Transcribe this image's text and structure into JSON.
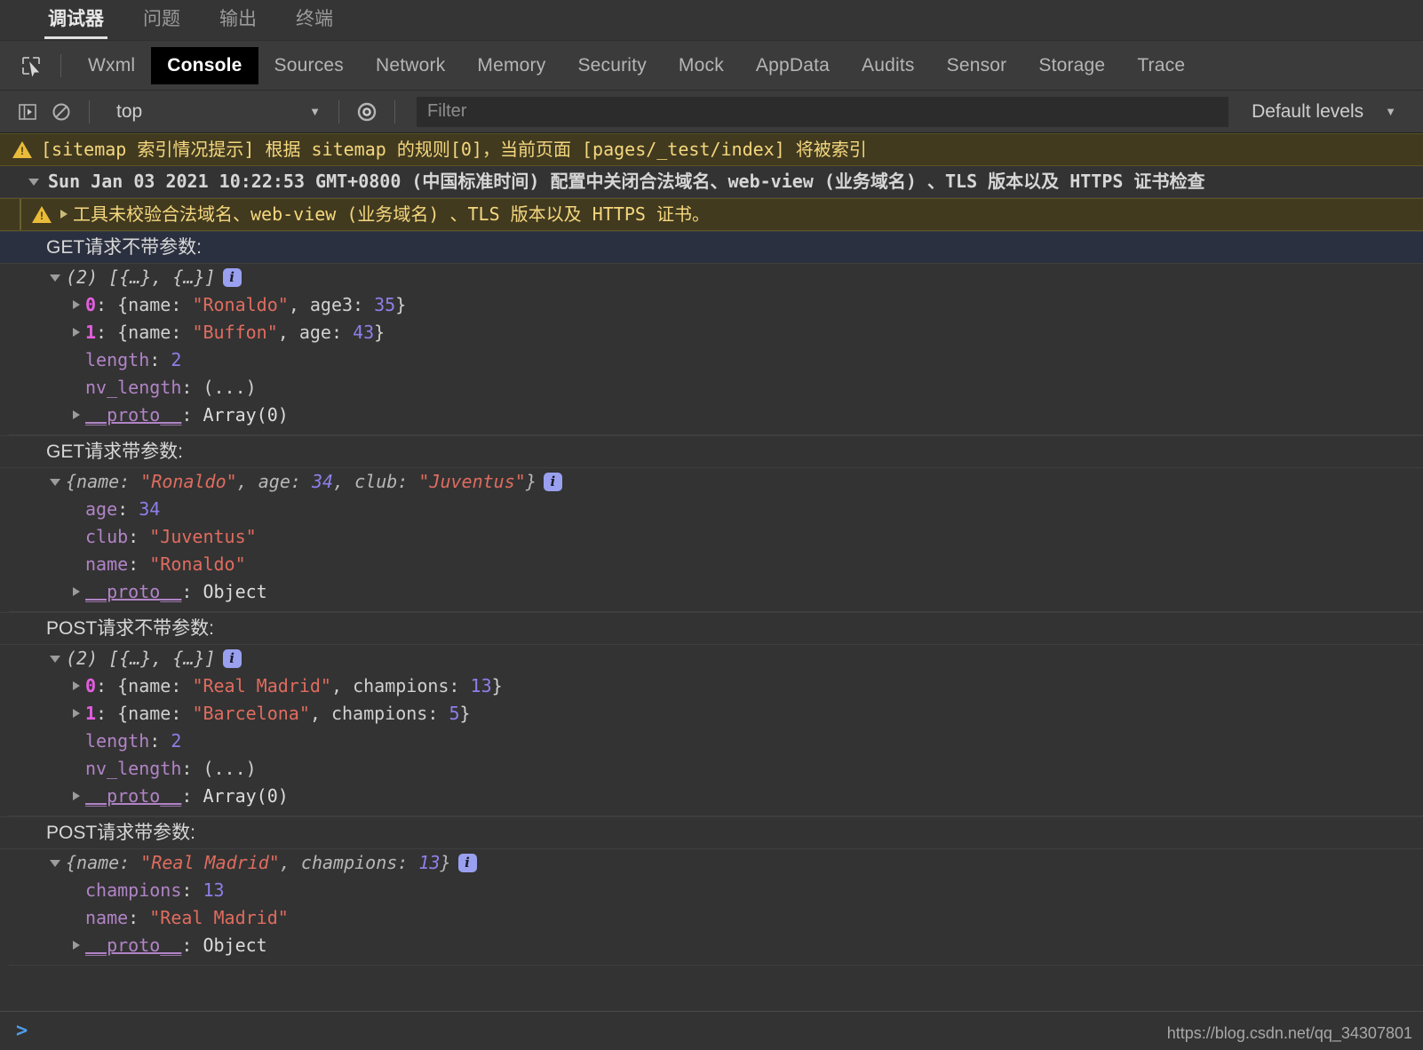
{
  "ide_tabs": [
    {
      "label": "调试器",
      "active": true
    },
    {
      "label": "问题",
      "active": false
    },
    {
      "label": "输出",
      "active": false
    },
    {
      "label": "终端",
      "active": false
    }
  ],
  "devtools_tabs": [
    {
      "label": "Wxml",
      "active": false
    },
    {
      "label": "Console",
      "active": true
    },
    {
      "label": "Sources",
      "active": false
    },
    {
      "label": "Network",
      "active": false
    },
    {
      "label": "Memory",
      "active": false
    },
    {
      "label": "Security",
      "active": false
    },
    {
      "label": "Mock",
      "active": false
    },
    {
      "label": "AppData",
      "active": false
    },
    {
      "label": "Audits",
      "active": false
    },
    {
      "label": "Sensor",
      "active": false
    },
    {
      "label": "Storage",
      "active": false
    },
    {
      "label": "Trace",
      "active": false
    }
  ],
  "toolbar": {
    "sidebar_toggle_icon": "console-sidebar-icon",
    "clear_icon": "clear-console-icon",
    "context_value": "top",
    "eye_icon": "live-expression-icon",
    "filter_placeholder": "Filter",
    "filter_value": "",
    "levels_label": "Default levels",
    "caret": "▼"
  },
  "messages": {
    "sitemap_warning": "[sitemap 索引情况提示] 根据 sitemap 的规则[0]，当前页面 [pages/_test/index] 将被索引",
    "date_group": "Sun Jan 03 2021 10:22:53 GMT+0800 (中国标准时间) 配置中关闭合法域名、web-view (业务域名) 、TLS 版本以及 HTTPS 证书检查",
    "nested_warning": "工具未校验合法域名、web-view (业务域名) 、TLS 版本以及 HTTPS 证书。"
  },
  "groups": [
    {
      "label": "GET请求不带参数:",
      "highlight": true,
      "preview": "(2) [{…}, {…}]",
      "preview_italic": true,
      "badge": "i",
      "lines": [
        {
          "indent": 1,
          "arrow": true,
          "key": "0",
          "key_style": "idx",
          "sep": ": ",
          "parts": [
            {
              "t": "{name: ",
              "c": "plain"
            },
            {
              "t": "\"Ronaldo\"",
              "c": "str"
            },
            {
              "t": ", age3: ",
              "c": "plain"
            },
            {
              "t": "35",
              "c": "num"
            },
            {
              "t": "}",
              "c": "plain"
            }
          ]
        },
        {
          "indent": 1,
          "arrow": true,
          "key": "1",
          "key_style": "idx",
          "sep": ": ",
          "parts": [
            {
              "t": "{name: ",
              "c": "plain"
            },
            {
              "t": "\"Buffon\"",
              "c": "str"
            },
            {
              "t": ", age: ",
              "c": "plain"
            },
            {
              "t": "43",
              "c": "num"
            },
            {
              "t": "}",
              "c": "plain"
            }
          ]
        },
        {
          "indent": 1,
          "arrow": false,
          "key": "length",
          "key_style": "key",
          "sep": ": ",
          "parts": [
            {
              "t": "2",
              "c": "num"
            }
          ]
        },
        {
          "indent": 1,
          "arrow": false,
          "key": "nv_length",
          "key_style": "key",
          "sep": ": ",
          "parts": [
            {
              "t": "(...)",
              "c": "plain"
            }
          ]
        },
        {
          "indent": 1,
          "arrow": true,
          "key": "__proto__",
          "key_style": "proto",
          "sep": ": ",
          "parts": [
            {
              "t": "Array(0)",
              "c": "white"
            }
          ]
        }
      ]
    },
    {
      "label": "GET请求带参数:",
      "highlight": false,
      "preview_parts": [
        {
          "t": "{name: ",
          "c": "dim"
        },
        {
          "t": "\"Ronaldo\"",
          "c": "str"
        },
        {
          "t": ", age: ",
          "c": "dim"
        },
        {
          "t": "34",
          "c": "num"
        },
        {
          "t": ", club: ",
          "c": "dim"
        },
        {
          "t": "\"Juventus\"",
          "c": "str"
        },
        {
          "t": "}",
          "c": "dim"
        }
      ],
      "preview_italic": true,
      "badge": "i",
      "lines": [
        {
          "indent": 1,
          "arrow": false,
          "key": "age",
          "key_style": "key",
          "sep": ": ",
          "parts": [
            {
              "t": "34",
              "c": "num"
            }
          ]
        },
        {
          "indent": 1,
          "arrow": false,
          "key": "club",
          "key_style": "key",
          "sep": ": ",
          "parts": [
            {
              "t": "\"Juventus\"",
              "c": "str"
            }
          ]
        },
        {
          "indent": 1,
          "arrow": false,
          "key": "name",
          "key_style": "key",
          "sep": ": ",
          "parts": [
            {
              "t": "\"Ronaldo\"",
              "c": "str"
            }
          ]
        },
        {
          "indent": 1,
          "arrow": true,
          "key": "__proto__",
          "key_style": "proto",
          "sep": ": ",
          "parts": [
            {
              "t": "Object",
              "c": "white"
            }
          ]
        }
      ]
    },
    {
      "label": "POST请求不带参数:",
      "highlight": false,
      "preview": "(2) [{…}, {…}]",
      "preview_italic": true,
      "badge": "i",
      "lines": [
        {
          "indent": 1,
          "arrow": true,
          "key": "0",
          "key_style": "idx",
          "sep": ": ",
          "parts": [
            {
              "t": "{name: ",
              "c": "plain"
            },
            {
              "t": "\"Real Madrid\"",
              "c": "str"
            },
            {
              "t": ", champions: ",
              "c": "plain"
            },
            {
              "t": "13",
              "c": "num"
            },
            {
              "t": "}",
              "c": "plain"
            }
          ]
        },
        {
          "indent": 1,
          "arrow": true,
          "key": "1",
          "key_style": "idx",
          "sep": ": ",
          "parts": [
            {
              "t": "{name: ",
              "c": "plain"
            },
            {
              "t": "\"Barcelona\"",
              "c": "str"
            },
            {
              "t": ", champions: ",
              "c": "plain"
            },
            {
              "t": "5",
              "c": "num"
            },
            {
              "t": "}",
              "c": "plain"
            }
          ]
        },
        {
          "indent": 1,
          "arrow": false,
          "key": "length",
          "key_style": "key",
          "sep": ": ",
          "parts": [
            {
              "t": "2",
              "c": "num"
            }
          ]
        },
        {
          "indent": 1,
          "arrow": false,
          "key": "nv_length",
          "key_style": "key",
          "sep": ": ",
          "parts": [
            {
              "t": "(...)",
              "c": "plain"
            }
          ]
        },
        {
          "indent": 1,
          "arrow": true,
          "key": "__proto__",
          "key_style": "proto",
          "sep": ": ",
          "parts": [
            {
              "t": "Array(0)",
              "c": "white"
            }
          ]
        }
      ]
    },
    {
      "label": "POST请求带参数:",
      "highlight": false,
      "preview_parts": [
        {
          "t": "{name: ",
          "c": "dim"
        },
        {
          "t": "\"Real Madrid\"",
          "c": "str"
        },
        {
          "t": ", champions: ",
          "c": "dim"
        },
        {
          "t": "13",
          "c": "num"
        },
        {
          "t": "}",
          "c": "dim"
        }
      ],
      "preview_italic": true,
      "badge": "i",
      "lines": [
        {
          "indent": 1,
          "arrow": false,
          "key": "champions",
          "key_style": "key",
          "sep": ": ",
          "parts": [
            {
              "t": "13",
              "c": "num"
            }
          ]
        },
        {
          "indent": 1,
          "arrow": false,
          "key": "name",
          "key_style": "key",
          "sep": ": ",
          "parts": [
            {
              "t": "\"Real Madrid\"",
              "c": "str"
            }
          ]
        },
        {
          "indent": 1,
          "arrow": true,
          "key": "__proto__",
          "key_style": "proto",
          "sep": ": ",
          "parts": [
            {
              "t": "Object",
              "c": "white"
            }
          ]
        }
      ]
    }
  ],
  "prompt": {
    "arrow": "❯"
  },
  "watermark": "https://blog.csdn.net/qq_34307801",
  "colors": {
    "accent_tab_active_bg": "#000000",
    "warning_bg": "#413a1f",
    "warning_text": "#f0d48a",
    "string": "#e06c5f",
    "number": "#8d7fe8",
    "key": "#b184c6",
    "index": "#e55ee0",
    "badge_bg": "#9aa0f0",
    "prompt_arrow": "#4c9eea",
    "panel_bg": "#333333"
  }
}
